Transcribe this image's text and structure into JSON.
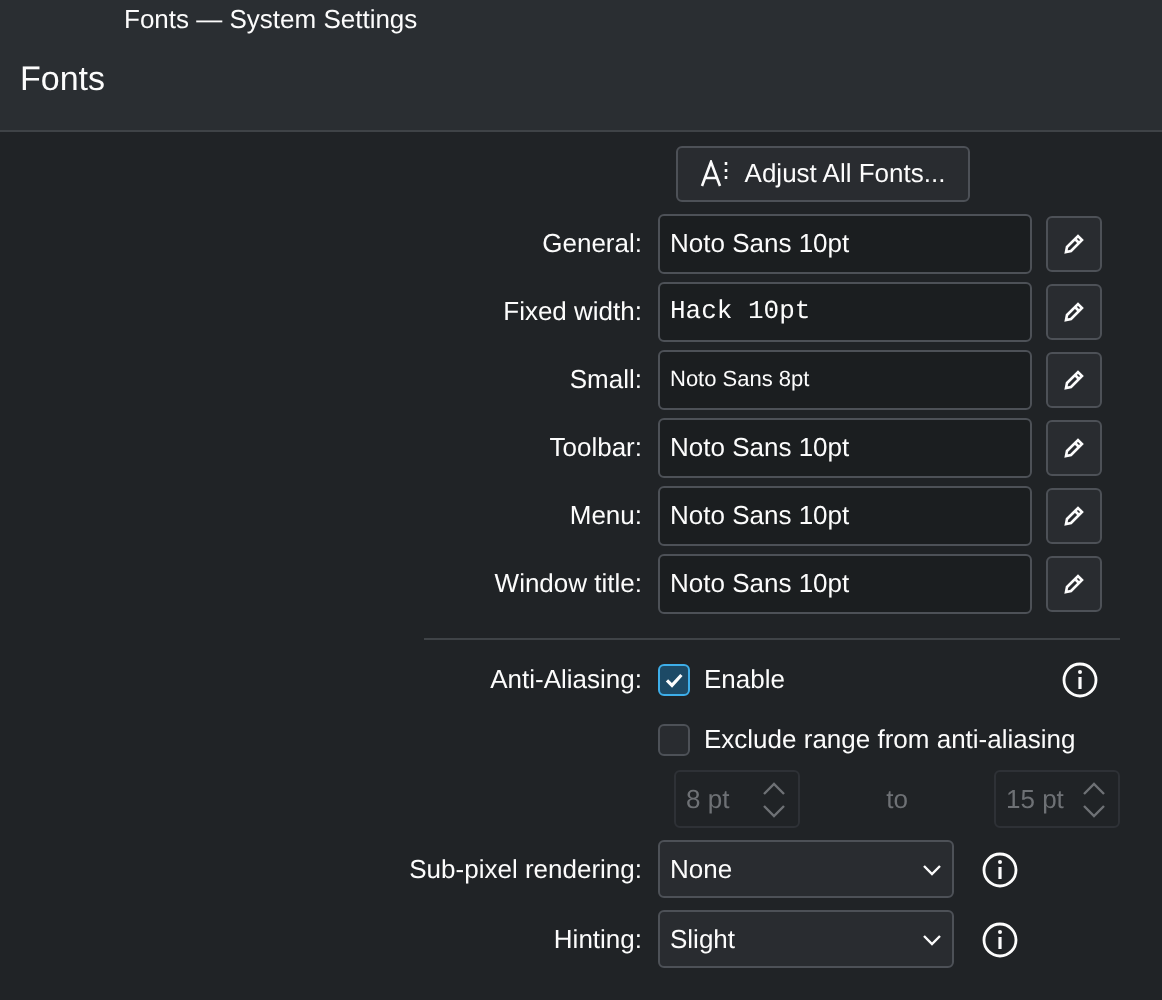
{
  "window": {
    "title": "Fonts — System Settings"
  },
  "page": {
    "title": "Fonts"
  },
  "adjust_button": {
    "label": "Adjust All Fonts..."
  },
  "fonts": [
    {
      "label": "General:",
      "value": "Noto Sans 10pt",
      "kind": "normal"
    },
    {
      "label": "Fixed width:",
      "value": "Hack 10pt",
      "kind": "mono"
    },
    {
      "label": "Small:",
      "value": "Noto Sans 8pt",
      "kind": "small"
    },
    {
      "label": "Toolbar:",
      "value": "Noto Sans 10pt",
      "kind": "normal"
    },
    {
      "label": "Menu:",
      "value": "Noto Sans 10pt",
      "kind": "normal"
    },
    {
      "label": "Window title:",
      "value": "Noto Sans 10pt",
      "kind": "normal"
    }
  ],
  "anti_aliasing": {
    "label": "Anti-Aliasing:",
    "enable": {
      "label": "Enable",
      "checked": true
    },
    "exclude": {
      "label": "Exclude range from anti-aliasing",
      "checked": false
    },
    "range": {
      "from": "8 pt",
      "to_label": "to",
      "to": "15 pt",
      "disabled": true
    }
  },
  "selects": [
    {
      "label": "Sub-pixel rendering:",
      "value": "None"
    },
    {
      "label": "Hinting:",
      "value": "Slight"
    }
  ]
}
